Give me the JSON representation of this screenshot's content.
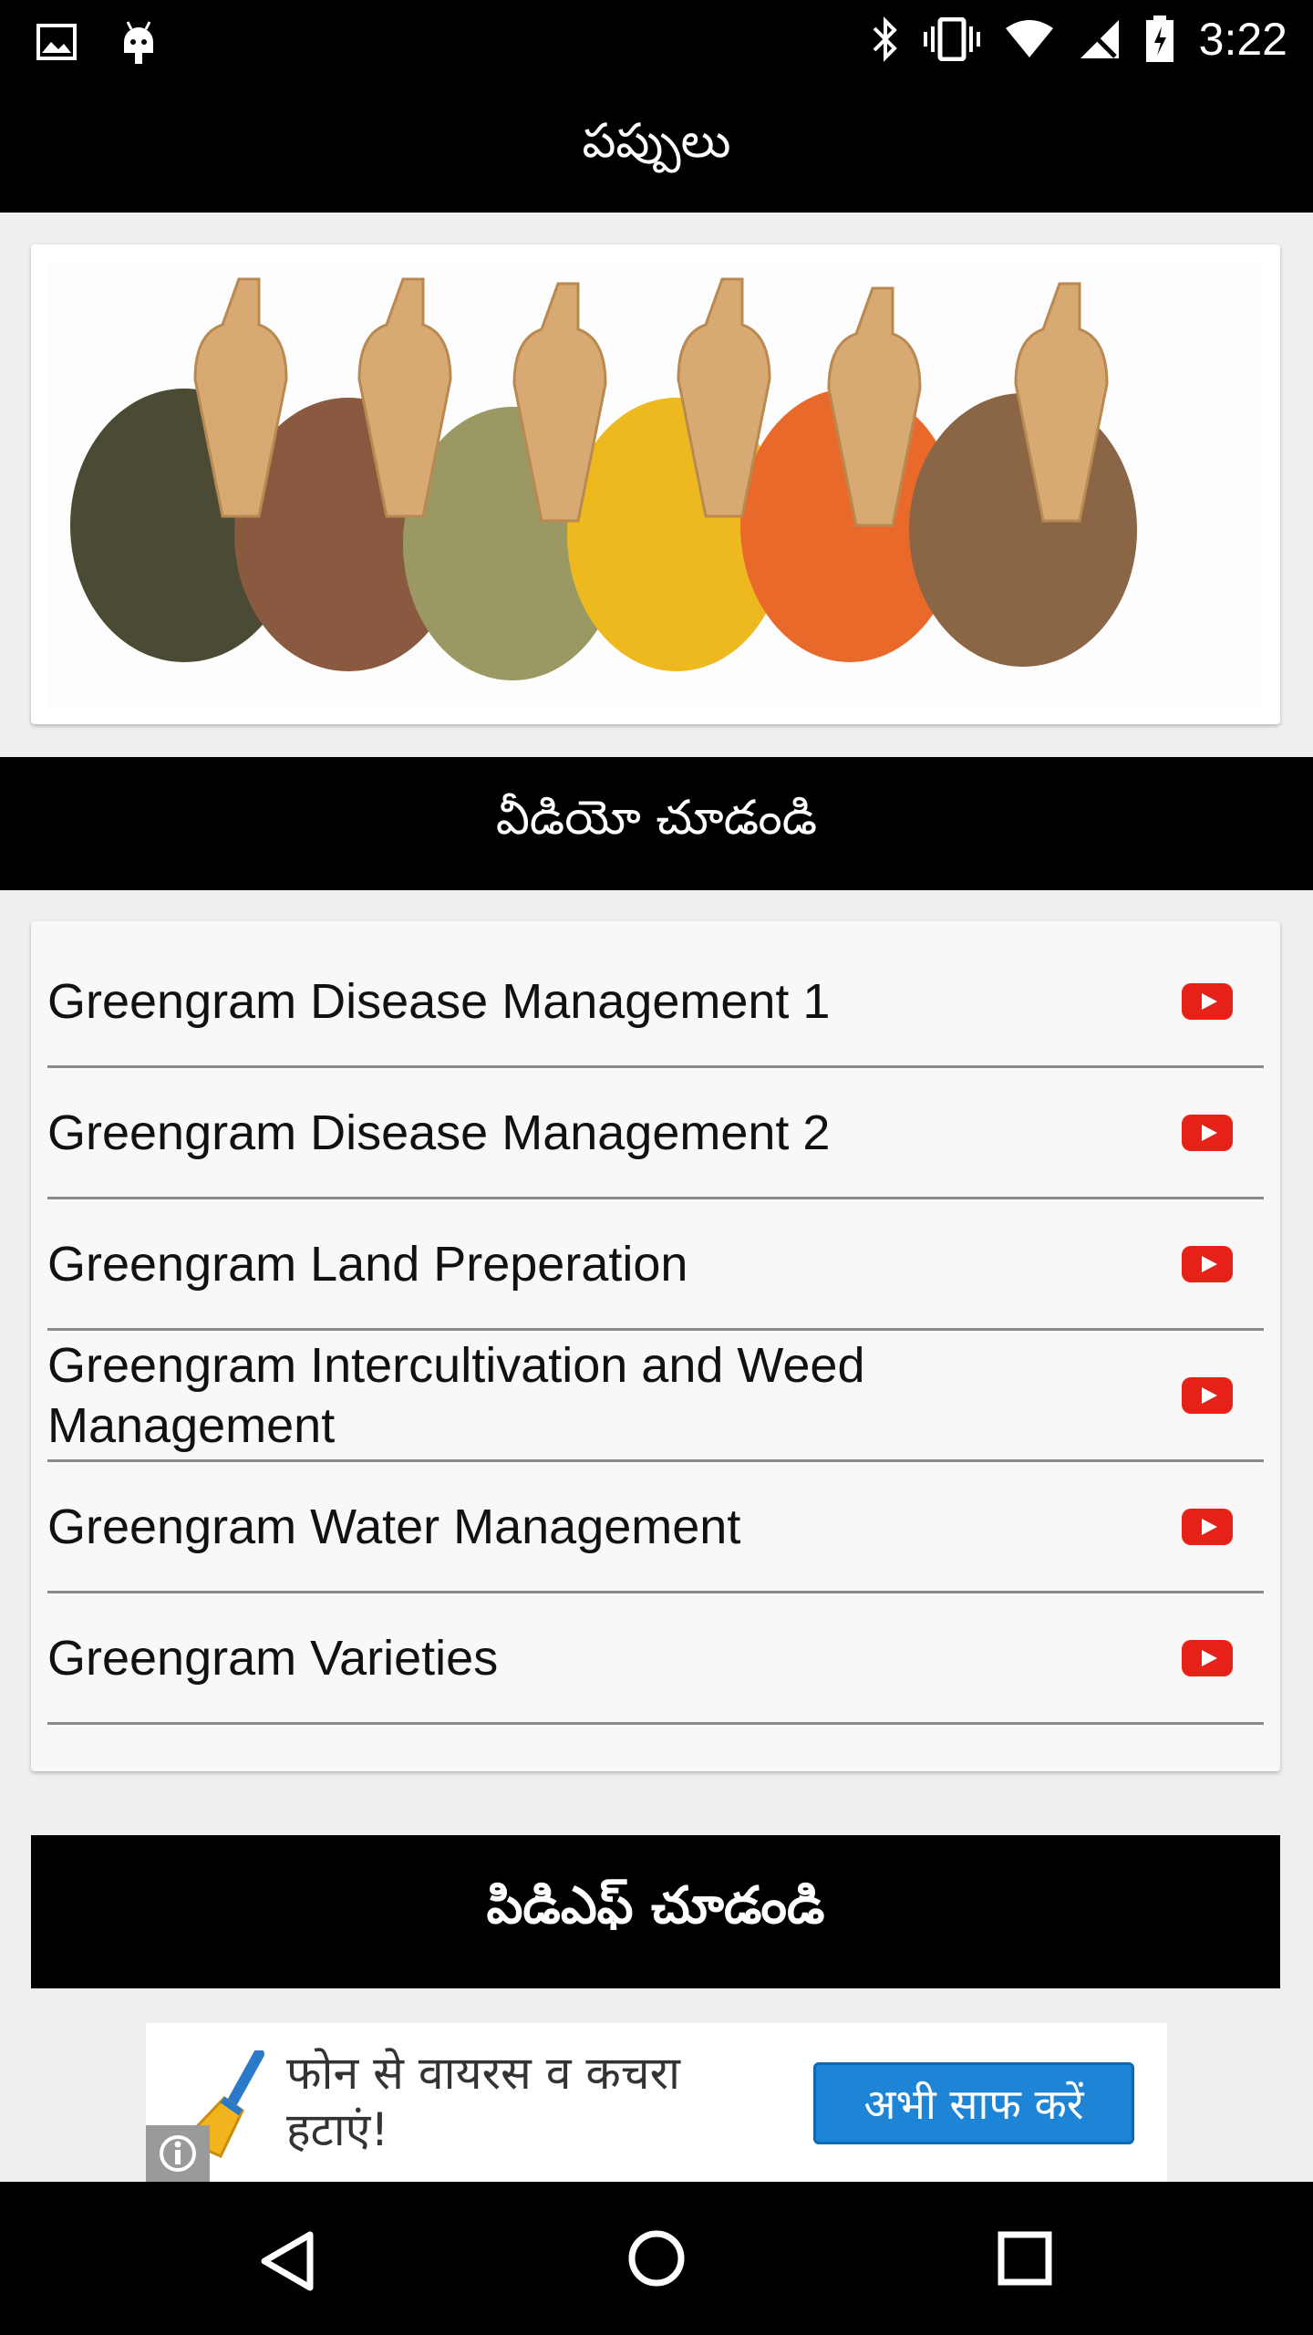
{
  "status_bar": {
    "time": "3:22",
    "left_icons": [
      "image-icon",
      "android-icon"
    ],
    "right_icons": [
      "bluetooth-icon",
      "vibrate-icon",
      "wifi-icon",
      "signal-icon",
      "battery-icon"
    ]
  },
  "app_bar": {
    "title": "పప్పులు"
  },
  "banner": {
    "image": "lentils-banner-image"
  },
  "video_section": {
    "title": "వీడియో చూడండి"
  },
  "video_list": [
    {
      "label": "Greengram Disease Management 1",
      "icon": "youtube-icon"
    },
    {
      "label": "Greengram Disease Management 2",
      "icon": "youtube-icon"
    },
    {
      "label": "Greengram Land Preperation",
      "icon": "youtube-icon"
    },
    {
      "label": "Greengram Intercultivation and Weed Management",
      "icon": "youtube-icon"
    },
    {
      "label": "Greengram Water Management",
      "icon": "youtube-icon"
    },
    {
      "label": "Greengram Varieties",
      "icon": "youtube-icon"
    }
  ],
  "pdf_section": {
    "title": "పిడిఎఫ్ చూడండి"
  },
  "ad": {
    "text": "फोन से वायरस व कचरा हटाएं!",
    "button": "अभी साफ करें",
    "icon": "broom-icon"
  },
  "nav_bar": {
    "icons": [
      "back-icon",
      "home-icon",
      "recents-icon"
    ]
  },
  "colors": {
    "bar": "#000000",
    "youtube_red": "#e62117",
    "ad_button": "#1e84d6",
    "page_background": "#efefef"
  }
}
